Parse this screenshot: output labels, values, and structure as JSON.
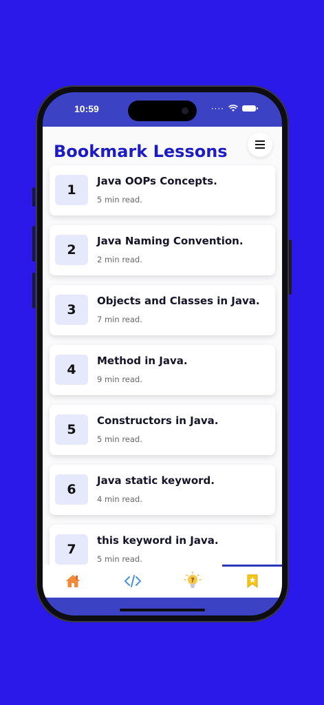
{
  "status": {
    "time": "10:59"
  },
  "header": {
    "title": "Bookmark Lessons",
    "menu_icon": "hamburger-icon"
  },
  "lessons": [
    {
      "number": "1",
      "title": "Java OOPs Concepts.",
      "read_time": "5 min read."
    },
    {
      "number": "2",
      "title": "Java Naming Convention.",
      "read_time": "2 min read."
    },
    {
      "number": "3",
      "title": "Objects and Classes in Java.",
      "read_time": "7 min read."
    },
    {
      "number": "4",
      "title": "Method in Java.",
      "read_time": "9 min read."
    },
    {
      "number": "5",
      "title": "Constructors in Java.",
      "read_time": "5 min read."
    },
    {
      "number": "6",
      "title": "Java static keyword.",
      "read_time": "4 min read."
    },
    {
      "number": "7",
      "title": "this keyword in Java.",
      "read_time": "5 min read."
    }
  ],
  "tabs": [
    {
      "icon": "home-icon",
      "color": "#f28a3c"
    },
    {
      "icon": "code-icon",
      "color": "#4a90e2"
    },
    {
      "icon": "quiz-bulb-icon",
      "color": "#f5b82e"
    },
    {
      "icon": "bookmark-icon",
      "color": "#f5c518",
      "active": true
    }
  ],
  "colors": {
    "background": "#2a19e8",
    "title": "#1d1cc4",
    "number_bg": "#e6e8fb",
    "active_indicator": "#2b36b8"
  }
}
